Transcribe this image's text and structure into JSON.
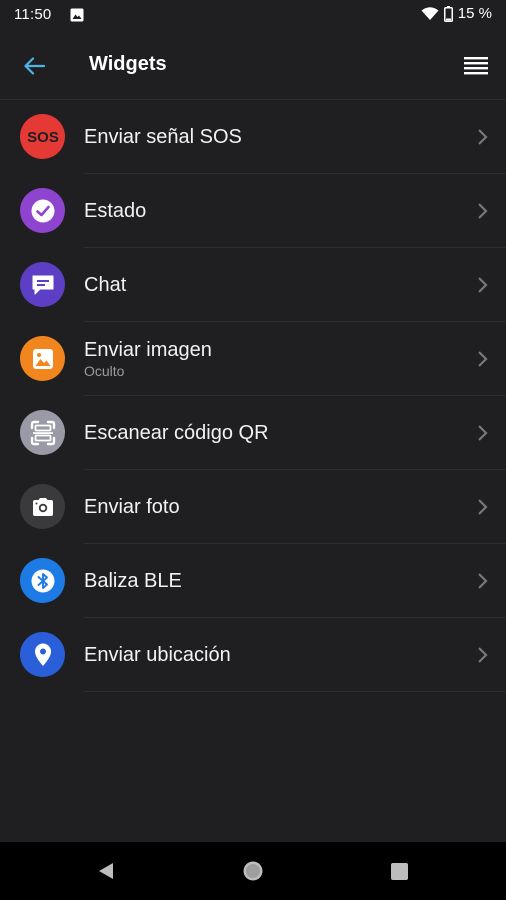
{
  "status_bar": {
    "time": "11:50",
    "battery": "15 %"
  },
  "app_bar": {
    "title": "Widgets",
    "back_icon": "arrow-left-icon",
    "menu_icon": "list-menu-icon"
  },
  "widgets": [
    {
      "label": "Enviar señal SOS",
      "sub": "",
      "icon": "sos-icon",
      "color": "#e53935",
      "glyph": "SOS"
    },
    {
      "label": "Estado",
      "sub": "",
      "icon": "check-circle-icon",
      "color": "#8e44ce"
    },
    {
      "label": "Chat",
      "sub": "",
      "icon": "chat-bubble-icon",
      "color": "#5c3fc4"
    },
    {
      "label": "Enviar imagen",
      "sub": "Oculto",
      "icon": "image-icon",
      "color": "#f0861d"
    },
    {
      "label": "Escanear código QR",
      "sub": "",
      "icon": "qr-scan-icon",
      "color": "#9a9aa6"
    },
    {
      "label": "Enviar foto",
      "sub": "",
      "icon": "camera-icon",
      "color": "#3a3a3d"
    },
    {
      "label": "Baliza BLE",
      "sub": "",
      "icon": "bluetooth-icon",
      "color": "#1e7be6"
    },
    {
      "label": "Enviar ubicación",
      "sub": "",
      "icon": "location-pin-icon",
      "color": "#2b5fd9"
    }
  ],
  "colors": {
    "background": "#1f1f21",
    "accent": "#4fb3e8",
    "divider": "#2e2e31",
    "secondary_text": "#9b9b9f"
  }
}
